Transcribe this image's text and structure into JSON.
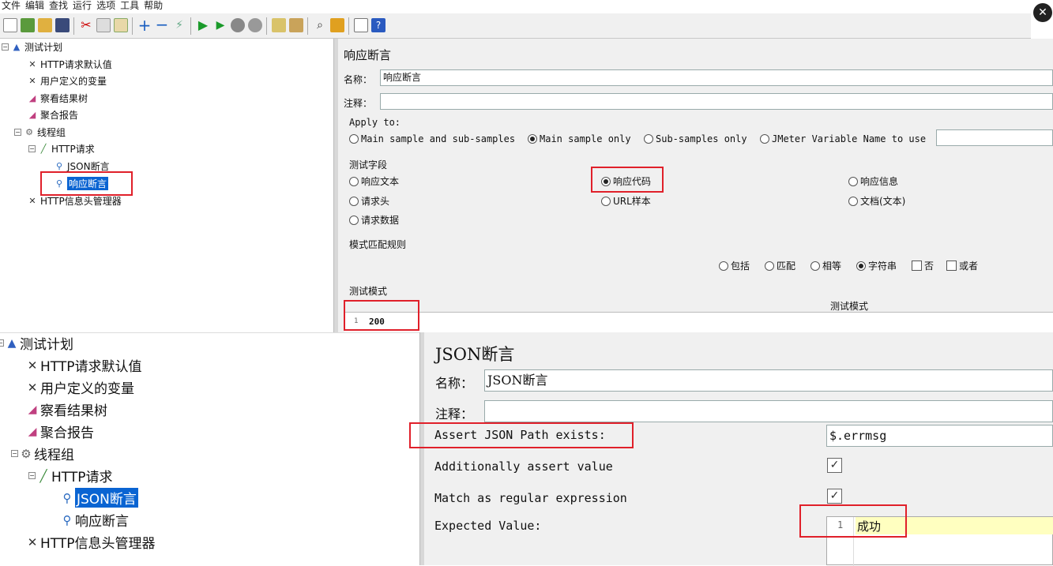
{
  "menu": [
    "文件",
    "编辑",
    "查找",
    "运行",
    "选项",
    "工具",
    "帮助"
  ],
  "close_glyph": "✕",
  "top_tree": {
    "items": [
      {
        "label": "测试计划"
      },
      {
        "label": "HTTP请求默认值"
      },
      {
        "label": "用户定义的变量"
      },
      {
        "label": "察看结果树"
      },
      {
        "label": "聚合报告"
      },
      {
        "label": "线程组"
      },
      {
        "label": "HTTP请求"
      },
      {
        "label": "JSON断言"
      },
      {
        "label": "响应断言"
      },
      {
        "label": "HTTP信息头管理器"
      }
    ]
  },
  "response_assertion": {
    "title": "响应断言",
    "name_label": "名称：",
    "name_value": "响应断言",
    "comment_label": "注释：",
    "apply_to_label": "Apply to:",
    "apply_options": [
      "Main sample and sub-samples",
      "Main sample only",
      "Sub-samples only",
      "JMeter Variable Name to use"
    ],
    "apply_selected": "Main sample only",
    "field_group_label": "测试字段",
    "fields": [
      "响应文本",
      "响应代码",
      "响应信息",
      "请求头",
      "URL样本",
      "文档(文本)",
      "请求数据"
    ],
    "field_selected": "响应代码",
    "pattern_rules_label": "模式匹配规则",
    "rules": [
      "包括",
      "匹配",
      "相等",
      "字符串"
    ],
    "rule_selected": "字符串",
    "checks": [
      "否",
      "或者"
    ],
    "test_patterns_label": "测试模式",
    "test_patterns_header": "测试模式",
    "line_no": "1",
    "pattern_value": "200"
  },
  "bottom_tree": {
    "items": [
      {
        "label": "测试计划"
      },
      {
        "label": "HTTP请求默认值"
      },
      {
        "label": "用户定义的变量"
      },
      {
        "label": "察看结果树"
      },
      {
        "label": "聚合报告"
      },
      {
        "label": "线程组"
      },
      {
        "label": "HTTP请求"
      },
      {
        "label": "JSON断言"
      },
      {
        "label": "响应断言"
      },
      {
        "label": "HTTP信息头管理器"
      }
    ]
  },
  "json_assertion": {
    "title": "JSON断言",
    "name_label": "名称：",
    "name_value": "JSON断言",
    "comment_label": "注释：",
    "path_label": "Assert JSON Path exists:",
    "path_value": "$.errmsg",
    "additionally_label": "Additionally assert value",
    "regex_label": "Match as regular expression",
    "expected_label": "Expected Value:",
    "line_no": "1",
    "expected_value": "成功",
    "check_glyph": "✓"
  },
  "colors": {
    "highlight": "#e0202a",
    "selection": "#0a64d2",
    "editor_yellow": "#ffffc0"
  }
}
